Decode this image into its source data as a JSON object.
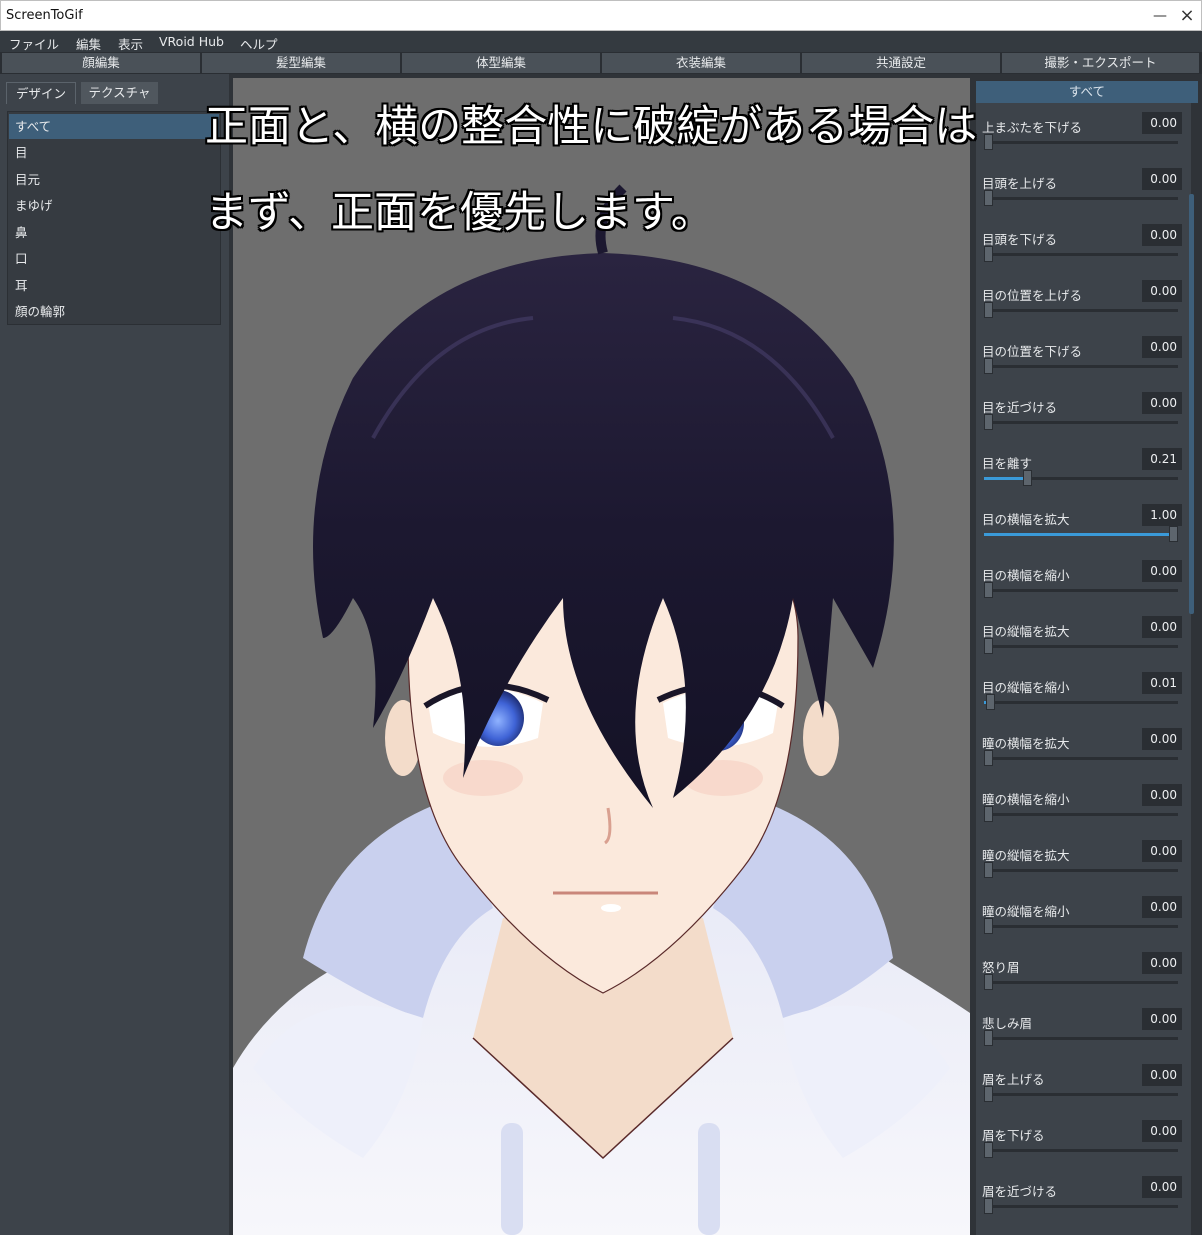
{
  "window": {
    "title": "ScreenToGif"
  },
  "menu": [
    "ファイル",
    "編集",
    "表示",
    "VRoid Hub",
    "ヘルプ"
  ],
  "main_tabs": [
    "顔編集",
    "髪型編集",
    "体型編集",
    "衣装編集",
    "共通設定",
    "撮影・エクスポート"
  ],
  "left_panel": {
    "sub_tabs": [
      "デザイン",
      "テクスチャ"
    ],
    "categories": [
      "すべて",
      "目",
      "目元",
      "まゆげ",
      "鼻",
      "口",
      "耳",
      "顔の輪郭"
    ],
    "selected_category": "すべて"
  },
  "caption": {
    "line1": "正面と、横の整合性に破綻がある場合は",
    "line2": "まず、正面を優先します。"
  },
  "right_panel": {
    "header": "すべて",
    "params": [
      {
        "label": "上まぶたを下げる",
        "value": "0.00",
        "level": 0.0
      },
      {
        "label": "目頭を上げる",
        "value": "0.00",
        "level": 0.0
      },
      {
        "label": "目頭を下げる",
        "value": "0.00",
        "level": 0.0
      },
      {
        "label": "目の位置を上げる",
        "value": "0.00",
        "level": 0.0
      },
      {
        "label": "目の位置を下げる",
        "value": "0.00",
        "level": 0.0
      },
      {
        "label": "目を近づける",
        "value": "0.00",
        "level": 0.0
      },
      {
        "label": "目を離す",
        "value": "0.21",
        "level": 0.21
      },
      {
        "label": "目の横幅を拡大",
        "value": "1.00",
        "level": 1.0
      },
      {
        "label": "目の横幅を縮小",
        "value": "0.00",
        "level": 0.0
      },
      {
        "label": "目の縦幅を拡大",
        "value": "0.00",
        "level": 0.0
      },
      {
        "label": "目の縦幅を縮小",
        "value": "0.01",
        "level": 0.01
      },
      {
        "label": "瞳の横幅を拡大",
        "value": "0.00",
        "level": 0.0
      },
      {
        "label": "瞳の横幅を縮小",
        "value": "0.00",
        "level": 0.0
      },
      {
        "label": "瞳の縦幅を拡大",
        "value": "0.00",
        "level": 0.0
      },
      {
        "label": "瞳の縦幅を縮小",
        "value": "0.00",
        "level": 0.0
      },
      {
        "label": "怒り眉",
        "value": "0.00",
        "level": 0.0
      },
      {
        "label": "悲しみ眉",
        "value": "0.00",
        "level": 0.0
      },
      {
        "label": "眉を上げる",
        "value": "0.00",
        "level": 0.0
      },
      {
        "label": "眉を下げる",
        "value": "0.00",
        "level": 0.0
      },
      {
        "label": "眉を近づける",
        "value": "0.00",
        "level": 0.0
      }
    ]
  },
  "colors": {
    "accent": "#3a9ad9",
    "selected": "#3e5f7a",
    "panel": "#3d434a",
    "viewport_bg": "#6e6e6e"
  }
}
